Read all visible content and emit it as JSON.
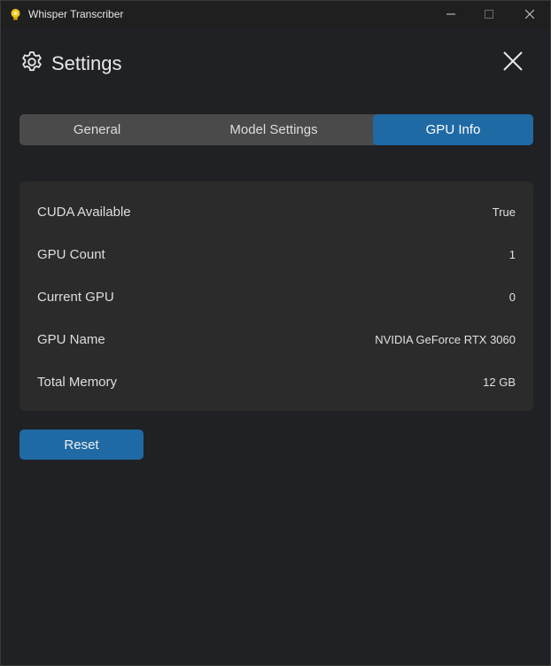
{
  "window": {
    "title": "Whisper Transcriber",
    "app_icon": "lightbulb-app-icon",
    "controls": [
      "minimize-icon",
      "maximize-icon",
      "close-icon"
    ]
  },
  "header": {
    "title": "Settings",
    "icon": "gear-icon",
    "close_icon": "close-icon"
  },
  "tabs": [
    {
      "label": "General",
      "active": false
    },
    {
      "label": "Model Settings",
      "active": false
    },
    {
      "label": "GPU Info",
      "active": true
    }
  ],
  "gpu_info": [
    {
      "label": "CUDA Available",
      "value": "True"
    },
    {
      "label": "GPU Count",
      "value": "1"
    },
    {
      "label": "Current GPU",
      "value": "0"
    },
    {
      "label": "GPU Name",
      "value": "NVIDIA GeForce RTX 3060"
    },
    {
      "label": "Total Memory",
      "value": "12 GB"
    }
  ],
  "actions": {
    "reset_label": "Reset"
  },
  "colors": {
    "accent": "#1f6aa5",
    "background": "#202124",
    "panel": "#2b2b2b",
    "tab_bar": "#4a4a4a"
  }
}
